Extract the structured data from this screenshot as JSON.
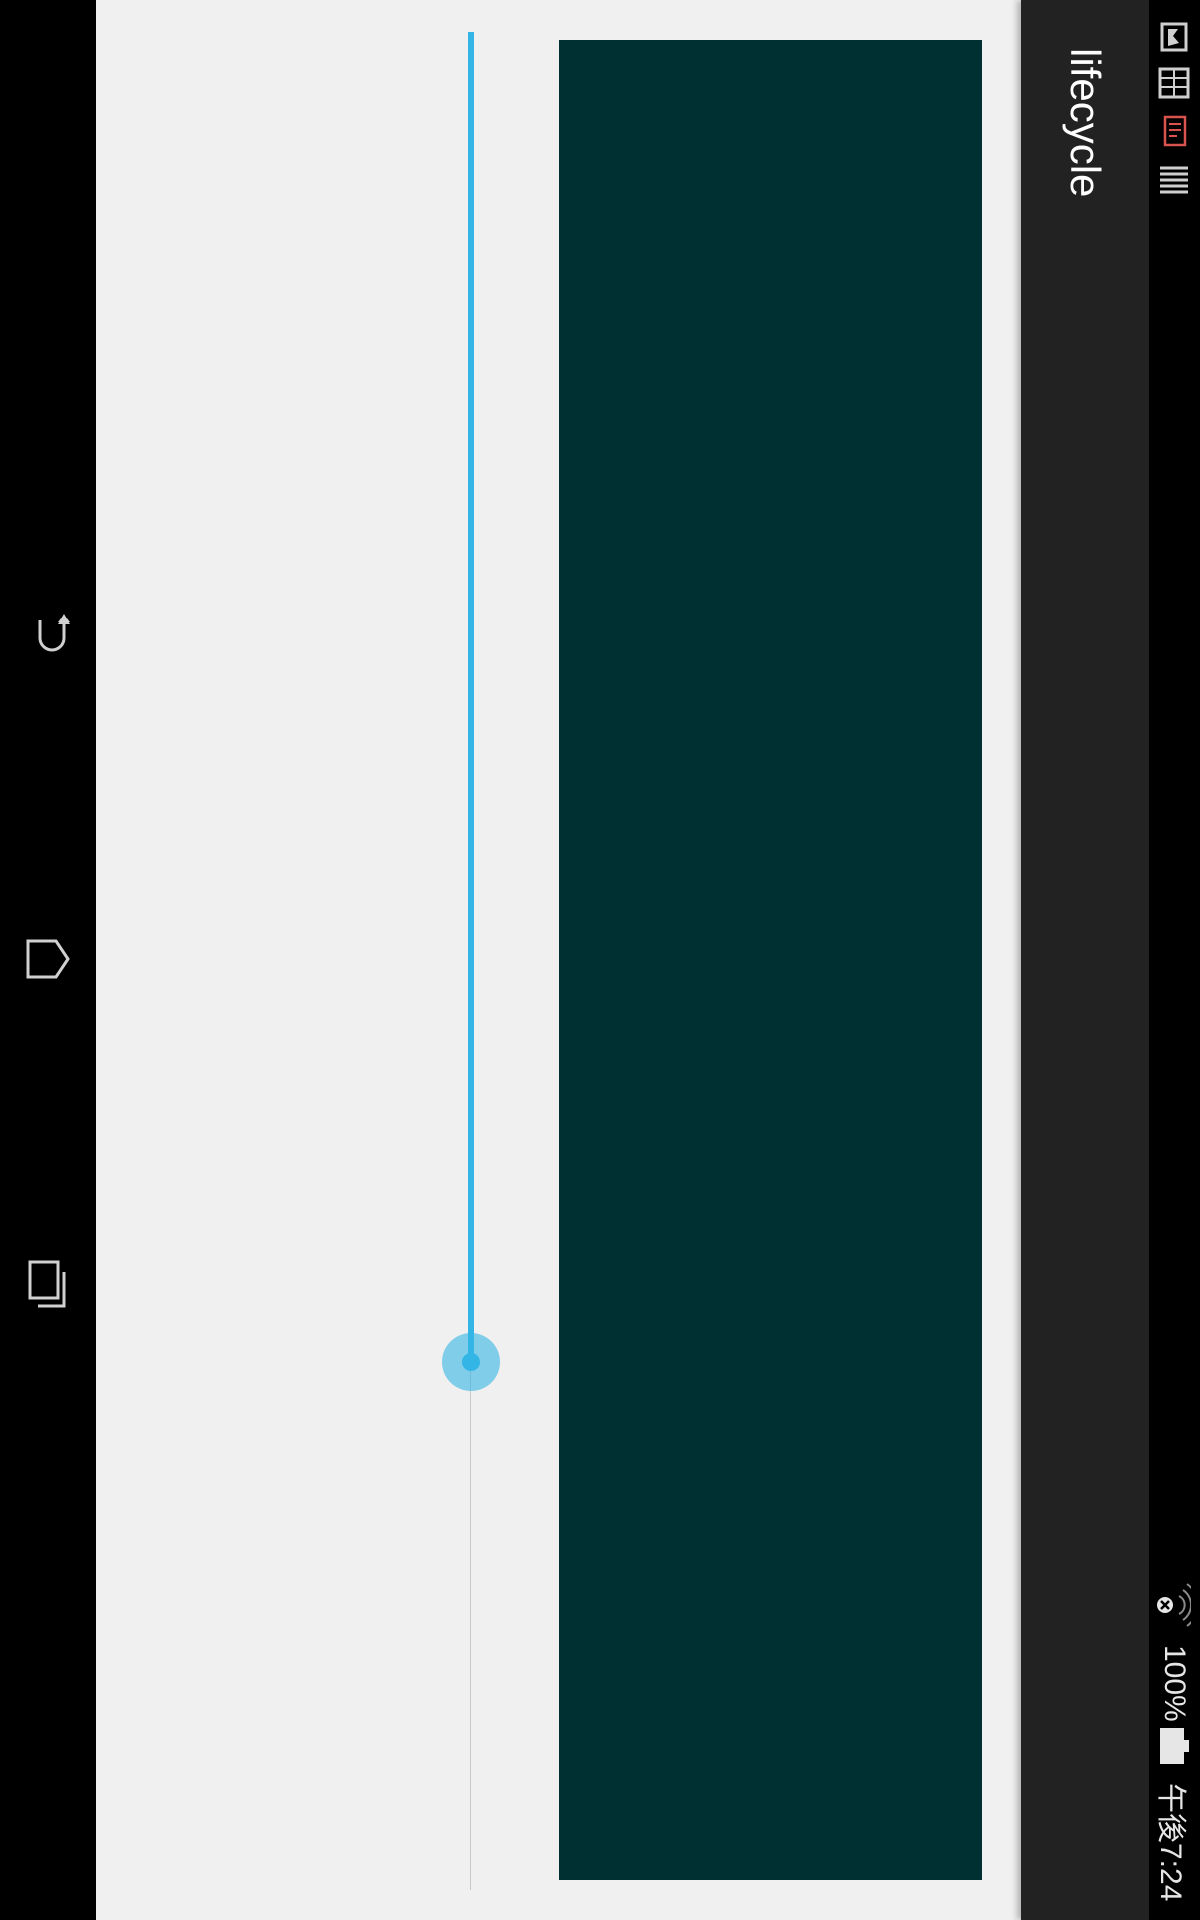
{
  "app": {
    "title": "lifecycle"
  },
  "slider": {
    "value_percent": 71.6,
    "accent_color": "#33b5e5"
  },
  "panel": {
    "color": "#013032"
  },
  "status_bar": {
    "battery": "100%",
    "time": "午後7:24",
    "icons": [
      "notification-icon-1",
      "notification-icon-2",
      "notification-icon-3",
      "notification-icon-4",
      "wifi-off-icon",
      "battery-icon"
    ]
  },
  "navigation": {
    "buttons": [
      "back-icon",
      "home-icon",
      "recents-icon"
    ]
  }
}
